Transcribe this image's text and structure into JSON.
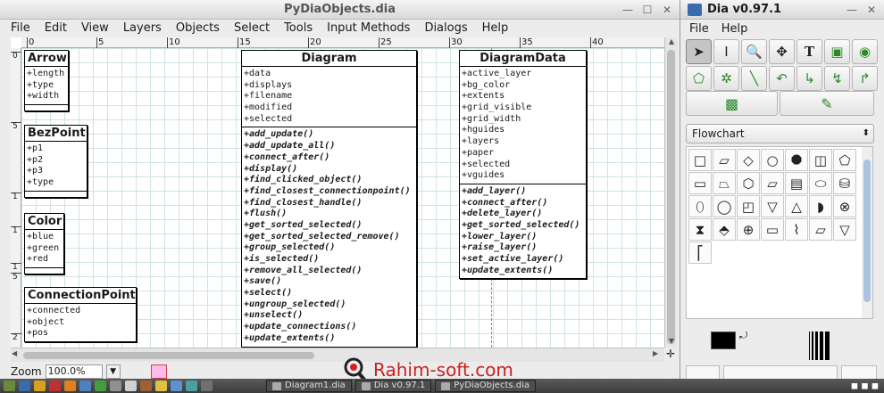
{
  "main_window": {
    "title": "PyDiaObjects.dia",
    "menu": [
      "File",
      "Edit",
      "View",
      "Layers",
      "Objects",
      "Select",
      "Tools",
      "Input Methods",
      "Dialogs",
      "Help"
    ],
    "ruler_h_ticks": [
      "0",
      "5",
      "10",
      "15",
      "20",
      "25",
      "30",
      "35",
      "40"
    ],
    "ruler_v_ticks": [
      "0",
      "5",
      "1",
      "1",
      "1",
      "5",
      "2"
    ],
    "classes": {
      "arrow": {
        "name": "Arrow",
        "attributes": [
          "+length",
          "+type",
          "+width"
        ]
      },
      "bezpoint": {
        "name": "BezPoint",
        "attributes": [
          "+p1",
          "+p2",
          "+p3",
          "+type"
        ]
      },
      "color": {
        "name": "Color",
        "attributes": [
          "+blue",
          "+green",
          "+red"
        ]
      },
      "connectionpoint": {
        "name": "ConnectionPoint",
        "attributes": [
          "+connected",
          "+object",
          "+pos"
        ]
      },
      "diagram": {
        "name": "Diagram",
        "attributes": [
          "+data",
          "+displays",
          "+filename",
          "+modified",
          "+selected"
        ],
        "operations": [
          "+add_update()",
          "+add_update_all()",
          "+connect_after()",
          "+display()",
          "+find_clicked_object()",
          "+find_closest_connectionpoint()",
          "+find_closest_handle()",
          "+flush()",
          "+get_sorted_selected()",
          "+get_sorted_selected_remove()",
          "+group_selected()",
          "+is_selected()",
          "+remove_all_selected()",
          "+save()",
          "+select()",
          "+ungroup_selected()",
          "+unselect()",
          "+update_connections()",
          "+update_extents()"
        ]
      },
      "diagramdata": {
        "name": "DiagramData",
        "attributes": [
          "+active_layer",
          "+bg_color",
          "+extents",
          "+grid_visible",
          "+grid_width",
          "+hguides",
          "+layers",
          "+paper",
          "+selected",
          "+vguides"
        ],
        "operations": [
          "+add_layer()",
          "+connect_after()",
          "+delete_layer()",
          "+get_sorted_selected()",
          "+lower_layer()",
          "+raise_layer()",
          "+set_active_layer()",
          "+update_extents()"
        ]
      }
    },
    "zoom": {
      "label": "Zoom",
      "value": "100.0%"
    }
  },
  "toolbox": {
    "title": "Dia v0.97.1",
    "menu": [
      "File",
      "Help"
    ],
    "sheet": "Flowchart"
  },
  "taskbar": {
    "tasks": [
      "Diagram1.dia",
      "Dia v0.97.1",
      "PyDiaObjects.dia"
    ]
  },
  "watermark": "Rahim-soft.com"
}
